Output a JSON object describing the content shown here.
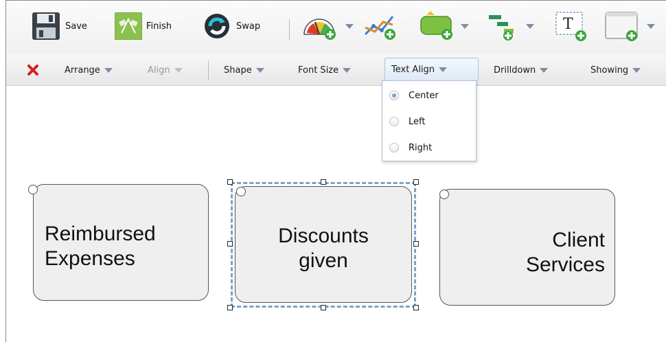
{
  "toolbar": {
    "save_label": "Save",
    "finish_label": "Finish",
    "swap_label": "Swap"
  },
  "toolbar2": {
    "delete_icon": "red-x-delete-icon",
    "arrange_label": "Arrange",
    "align_label": "Align",
    "shape_label": "Shape",
    "font_size_label": "Font Size",
    "text_align_label": "Text Align",
    "drilldown_label": "Drilldown",
    "showing_label": "Showing"
  },
  "text_align_menu": {
    "options": [
      {
        "label": "Center",
        "selected": true
      },
      {
        "label": "Left",
        "selected": false
      },
      {
        "label": "Right",
        "selected": false
      }
    ]
  },
  "canvas": {
    "shapes": [
      {
        "text": "Reimbursed\nExpenses",
        "align": "left",
        "selected": false
      },
      {
        "text": "Discounts\ngiven",
        "align": "center",
        "selected": true
      },
      {
        "text": "Client\nServices",
        "align": "right",
        "selected": false
      }
    ]
  },
  "colors": {
    "accent": "#7aa3c8",
    "delete": "#d42020",
    "finish_bg": "#8cc04f",
    "add_green": "#3aa63a"
  }
}
